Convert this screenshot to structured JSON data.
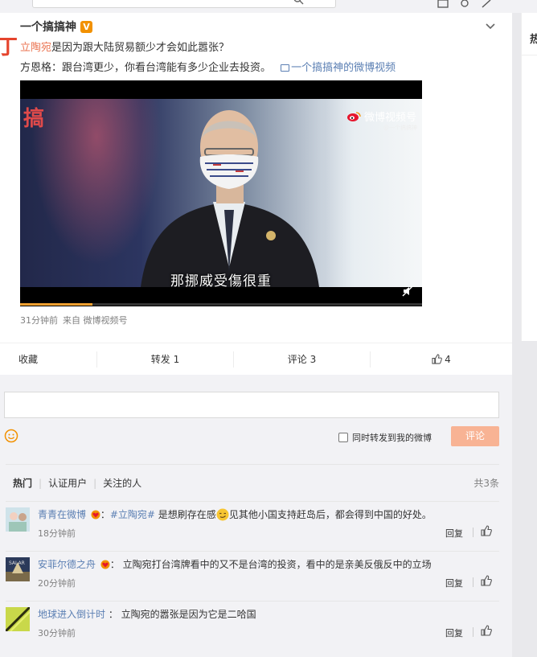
{
  "post": {
    "author": "一个搞搞神",
    "verified_badge": "V",
    "topic": "立陶宛",
    "title_rest": "是因为跟大陆贸易额少才会如此嚣张？",
    "description": "方恩格：跟台湾更少，你看台湾能有多少企业去投资。",
    "video_link": "一个搞搞神的微博视频",
    "video": {
      "subtitle": "那挪威受傷很重",
      "watermark": "微博视频号",
      "watermark_sub": "@一个搞搞神",
      "corner_logo": "搞",
      "progress": 0.18
    },
    "time": "31分钟前",
    "source": "来自 微博视频号"
  },
  "actions": {
    "favorite": "收藏",
    "repost": "转发 1",
    "comment": "评论 3",
    "like": "4"
  },
  "comment_box": {
    "placeholder": "",
    "also_repost": "同时转发到我的微博",
    "submit": "评论"
  },
  "comments_header": {
    "tabs": [
      "热门",
      "认证用户",
      "关注的人"
    ],
    "total": "共3条"
  },
  "comments": [
    {
      "user": "青青在微博",
      "tag": "#立陶宛#",
      "text_before": " 是想刷存在感",
      "text_after": "见其他小国支持赶岛后，都会得到中国的好处。",
      "time": "18分钟前",
      "reply": "回复"
    },
    {
      "user": "安菲尔德之舟",
      "text": "：  立陶宛打台湾牌看中的又不是台湾的投资，看中的是亲美反俄反中的立场",
      "time": "20分钟前",
      "reply": "回复"
    },
    {
      "user": "地球进入倒计时",
      "text": " ：  立陶宛的嚣张是因为它是二哈国",
      "time": "30分钟前",
      "reply": "回复"
    }
  ],
  "sidebar": {
    "title": "热"
  },
  "colors": {
    "topic": "#eb7350",
    "link": "#5b7fb3",
    "submit": "#f8b394",
    "badge": "#f29100"
  }
}
